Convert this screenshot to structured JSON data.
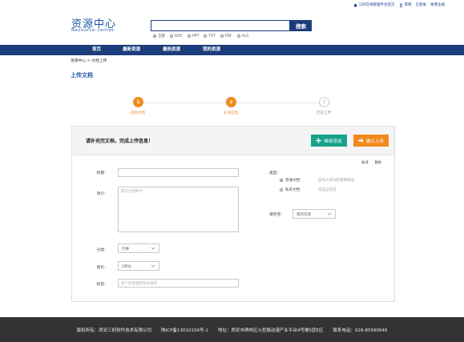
{
  "top_links": {
    "home_label": "三好在线管理平台首页",
    "user_label": "李晓",
    "logged_in_label": "已登录",
    "register_label": "免费注册"
  },
  "logo": {
    "title_cn": "资源中心",
    "title_en": "Resource center"
  },
  "search": {
    "value": "",
    "button_label": "搜索",
    "filetypes": [
      {
        "label": "全部",
        "checked": true
      },
      {
        "label": "DOC",
        "checked": false
      },
      {
        "label": "PPT",
        "checked": false
      },
      {
        "label": "TXT",
        "checked": false
      },
      {
        "label": "PDF",
        "checked": false
      },
      {
        "label": "XLS",
        "checked": false
      }
    ]
  },
  "nav": {
    "items": [
      "首页",
      "最新资源",
      "最热资源",
      "我的资源"
    ]
  },
  "breadcrumb": "资源中心 > 文档上传",
  "page_title": "上传文档",
  "steps": [
    {
      "number": "1",
      "label": "选择文档",
      "state": "done"
    },
    {
      "number": "2",
      "label": "补充信息",
      "state": "active"
    },
    {
      "number": "3",
      "label": "完成上传",
      "state": "pending"
    }
  ],
  "panel": {
    "heading": "请补充完文档，完成上传信息！",
    "add_button": "继续添加",
    "confirm_button": "确认上传",
    "link_cancel": "取消",
    "link_delete": "删除"
  },
  "form": {
    "title_label": "标题：",
    "title_value": "",
    "intro_label": "简介：",
    "intro_placeholder": "描写文档简介",
    "category_label": "分类：",
    "category_value": "行事",
    "price_label": "售价：",
    "price_value": "2积分",
    "tags_label": "标签：",
    "tags_placeholder": "多个标签请用逗号隔开",
    "type_label": "类型：",
    "type_options": [
      {
        "label": "普通文档",
        "desc": "任何人可以检索和阅读",
        "checked": true
      },
      {
        "label": "私有文档",
        "desc": "仅自己可见",
        "checked": false
      }
    ],
    "save_to_label": "保存至：",
    "save_to_value": "我的资源"
  },
  "footer": {
    "copyright": "版权所有：西安三好软件技术有限公司",
    "icp": "陕ICP备13010159号-1",
    "address": "地址：西安市碑林区火炬路动漫产业平台4号楼5层E区",
    "phone": "联系电话：029-85560646"
  },
  "colors": {
    "brand_blue": "#1c3d7c",
    "accent_orange": "#f28a1e",
    "accent_green": "#17a28a",
    "footer_bg": "#333333"
  }
}
